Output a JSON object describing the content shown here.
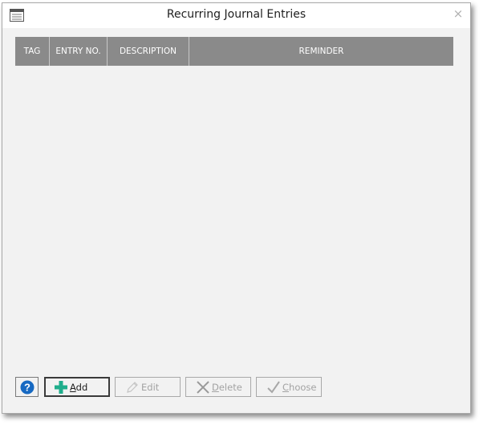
{
  "window": {
    "title": "Recurring Journal Entries",
    "close_glyph": "×",
    "title_icon": "window-icon"
  },
  "grid": {
    "columns": [
      "TAG",
      "ENTRY NO.",
      "DESCRIPTION",
      "REMINDER"
    ],
    "rows": []
  },
  "buttons": {
    "help": {
      "glyph": "?",
      "icon": "help-icon"
    },
    "add": {
      "label": "Add",
      "accel": "A",
      "rest": "dd",
      "icon": "plus-icon",
      "enabled": true
    },
    "edit": {
      "label": "Edit",
      "icon": "pencil-icon",
      "enabled": false
    },
    "delete": {
      "label": "Delete",
      "accel": "D",
      "rest": "elete",
      "icon": "x-icon",
      "enabled": false
    },
    "choose": {
      "label": "Choose",
      "accel": "C",
      "rest": "hoose",
      "icon": "checkmark-icon",
      "enabled": false
    }
  },
  "colors": {
    "header_bg": "#8a8a8a",
    "window_bg": "#f2f2f2",
    "add_icon": "#1fae8c",
    "help_icon": "#1769c2"
  }
}
